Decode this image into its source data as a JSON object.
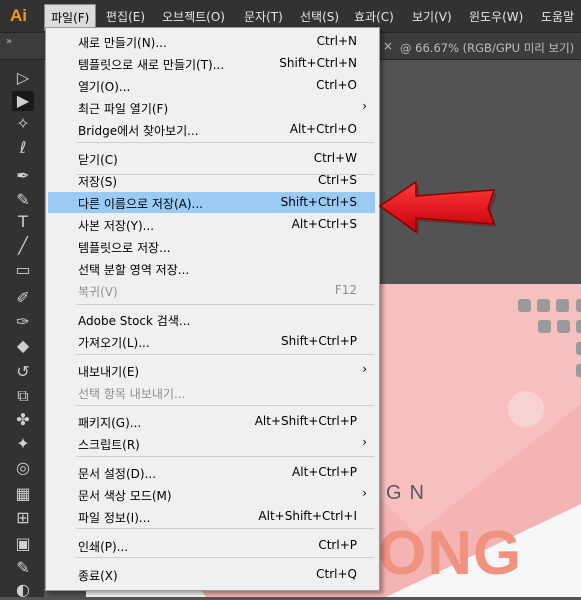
{
  "app": {
    "logo": "Ai"
  },
  "menubar": {
    "items": [
      "파일(F)",
      "편집(E)",
      "오브젝트(O)",
      "문자(T)",
      "선택(S)",
      "효과(C)",
      "보기(V)",
      "윈도우(W)",
      "도움말"
    ]
  },
  "document": {
    "collapse_icon": "»",
    "close_icon": "×",
    "tab_title": "@ 66.67% (RGB/GPU 미리 보기)"
  },
  "canvas": {
    "design_text": "GN",
    "big_text": "ONG"
  },
  "file_menu": {
    "items": [
      {
        "label": "새로 만들기(N)...",
        "shortcut": "Ctrl+N"
      },
      {
        "label": "템플릿으로 새로 만들기(T)...",
        "shortcut": "Shift+Ctrl+N"
      },
      {
        "label": "열기(O)...",
        "shortcut": "Ctrl+O"
      },
      {
        "label": "최근 파일 열기(F)",
        "shortcut": "",
        "submenu": true
      },
      {
        "label": "Bridge에서 찾아보기...",
        "shortcut": "Alt+Ctrl+O"
      },
      {
        "label": "닫기(C)",
        "shortcut": "Ctrl+W"
      },
      {
        "label": "저장(S)",
        "shortcut": "Ctrl+S"
      },
      {
        "label": "다른 이름으로 저장(A)...",
        "shortcut": "Shift+Ctrl+S",
        "highlighted": true
      },
      {
        "label": "사본 저장(Y)...",
        "shortcut": "Alt+Ctrl+S"
      },
      {
        "label": "템플릿으로 저장...",
        "shortcut": ""
      },
      {
        "label": "선택 분할 영역 저장...",
        "shortcut": ""
      },
      {
        "label": "복귀(V)",
        "shortcut": "F12",
        "disabled": true
      },
      {
        "label": "Adobe Stock 검색...",
        "shortcut": ""
      },
      {
        "label": "가져오기(L)...",
        "shortcut": "Shift+Ctrl+P"
      },
      {
        "label": "내보내기(E)",
        "shortcut": "",
        "submenu": true
      },
      {
        "label": "선택 항목 내보내기...",
        "shortcut": "",
        "disabled": true
      },
      {
        "label": "패키지(G)...",
        "shortcut": "Alt+Shift+Ctrl+P"
      },
      {
        "label": "스크립트(R)",
        "shortcut": "",
        "submenu": true
      },
      {
        "label": "문서 설정(D)...",
        "shortcut": "Alt+Ctrl+P"
      },
      {
        "label": "문서 색상 모드(M)",
        "shortcut": "",
        "submenu": true
      },
      {
        "label": "파일 정보(I)...",
        "shortcut": "Alt+Shift+Ctrl+I"
      },
      {
        "label": "인쇄(P)...",
        "shortcut": "Ctrl+P"
      },
      {
        "label": "종료(X)",
        "shortcut": "Ctrl+Q"
      }
    ],
    "submenu_arrow": "›"
  },
  "tools": [
    {
      "icon": "selection-tool-icon",
      "glyph": "▷"
    },
    {
      "icon": "direct-selection-tool-icon",
      "glyph": "▶"
    },
    {
      "icon": "magic-wand-tool-icon",
      "glyph": "✧"
    },
    {
      "icon": "lasso-tool-icon",
      "glyph": "ℓ"
    },
    {
      "icon": "pen-tool-icon",
      "glyph": "✒"
    },
    {
      "icon": "curvature-tool-icon",
      "glyph": "✎"
    },
    {
      "icon": "type-tool-icon",
      "glyph": "T"
    },
    {
      "icon": "line-tool-icon",
      "glyph": "╱"
    },
    {
      "icon": "rectangle-tool-icon",
      "glyph": "▭"
    },
    {
      "icon": "paintbrush-tool-icon",
      "glyph": "✐"
    },
    {
      "icon": "blob-brush-tool-icon",
      "glyph": "✑"
    },
    {
      "icon": "eraser-tool-icon",
      "glyph": "◆"
    },
    {
      "icon": "rotate-tool-icon",
      "glyph": "↺"
    },
    {
      "icon": "scale-tool-icon",
      "glyph": "⧉"
    },
    {
      "icon": "puppet-warp-tool-icon",
      "glyph": "✤"
    },
    {
      "icon": "pin-tool-icon",
      "glyph": "✦"
    },
    {
      "icon": "shape-builder-tool-icon",
      "glyph": "◎"
    },
    {
      "icon": "perspective-grid-tool-icon",
      "glyph": "▦"
    },
    {
      "icon": "mesh-tool-icon",
      "glyph": "⊞"
    },
    {
      "icon": "gradient-tool-icon",
      "glyph": "▣"
    },
    {
      "icon": "eyedropper-tool-icon",
      "glyph": "✎"
    },
    {
      "icon": "blend-tool-icon",
      "glyph": "◐"
    }
  ],
  "colors": {
    "menubar_bg": "#323232",
    "menu_highlight": "#99cbf4",
    "accent_logo": "#f7941e",
    "artboard_pink": "#f4b4b4",
    "arrow_red": "#e8232a"
  }
}
